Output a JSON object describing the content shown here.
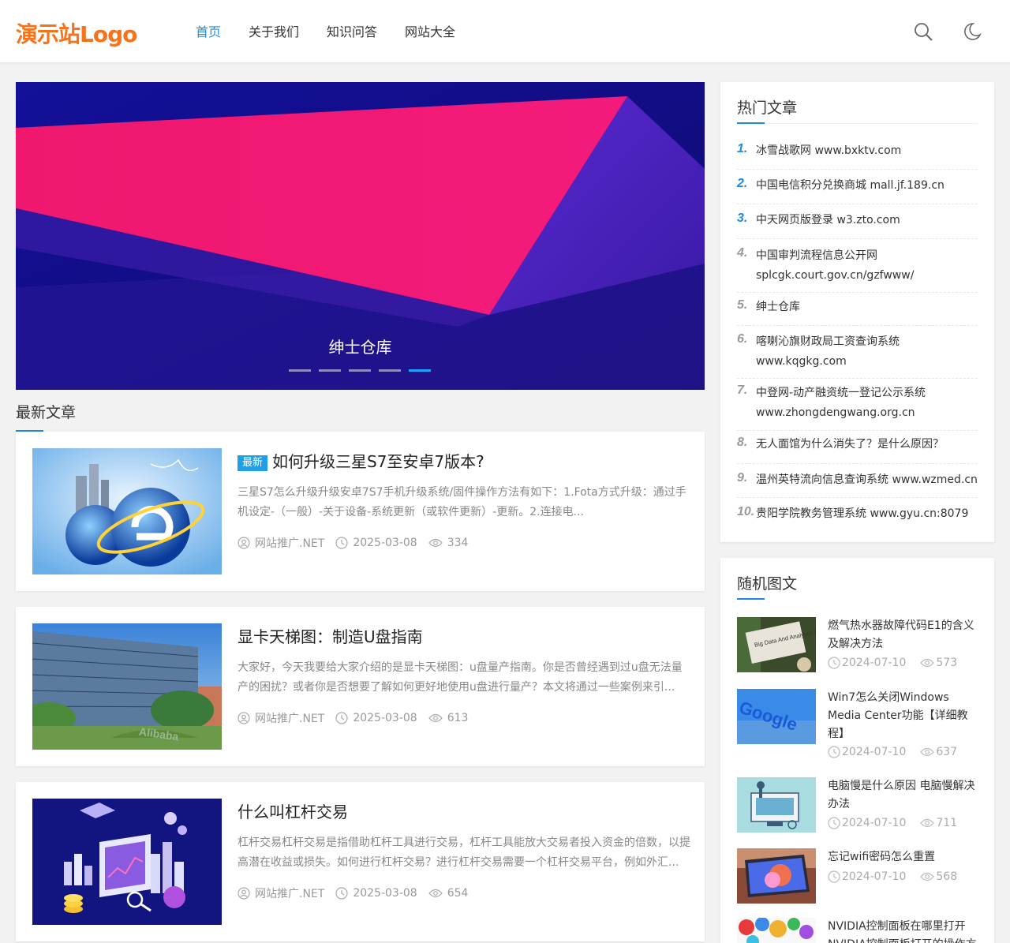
{
  "header": {
    "logo": "演示站Logo",
    "nav": [
      "首页",
      "关于我们",
      "知识问答",
      "网站大全"
    ],
    "search_icon": "search-icon",
    "theme_icon": "moon-icon"
  },
  "banner": {
    "caption": "绅士仓库",
    "slide_count": 5,
    "active_slide": 5
  },
  "latest": {
    "title": "最新文章",
    "articles": [
      {
        "badge": "最新",
        "title": "如何升级三星S7至安卓7版本?",
        "excerpt": "三星S7怎么升级升级安卓7S7手机升级系统/固件操作方法有如下：1.Fota方式升级：通过手机设定-（一般）-关于设备-系统更新（或软件更新）-更新。2.连接电...",
        "author": "网站推广.NET",
        "date": "2025-03-08",
        "views": "334"
      },
      {
        "badge": "",
        "title": "显卡天梯图：制造U盘指南",
        "excerpt": "大家好，今天我要给大家介绍的是显卡天梯图：u盘量产指南。你是否曾经遇到过u盘无法量产的困扰？或者你是否想要了解如何更好地使用u盘进行量产？本文将通过一些案例来引...",
        "author": "网站推广.NET",
        "date": "2025-03-08",
        "views": "613"
      },
      {
        "badge": "",
        "title": "什么叫杠杆交易",
        "excerpt": "杠杆交易杠杆交易是指借助杠杆工具进行交易，杠杆工具能放大交易者投入资金的倍数，以提高潜在收益或损失。如何进行杠杆交易？进行杠杆交易需要一个杠杆交易平台，例如外汇...",
        "author": "网站推广.NET",
        "date": "2025-03-08",
        "views": "654"
      }
    ]
  },
  "hot": {
    "title": "热门文章",
    "items": [
      {
        "num": "1.",
        "text": "冰雪战歌网 www.bxktv.com"
      },
      {
        "num": "2.",
        "text": "中国电信积分兑换商城 mall.jf.189.cn"
      },
      {
        "num": "3.",
        "text": "中天网页版登录 w3.zto.com"
      },
      {
        "num": "4.",
        "text": "中国审判流程信息公开网 splcgk.court.gov.cn/gzfwww/"
      },
      {
        "num": "5.",
        "text": "绅士仓库"
      },
      {
        "num": "6.",
        "text": "喀喇沁旗财政局工资查询系统 www.kqgkg.com"
      },
      {
        "num": "7.",
        "text": "中登网-动产融资统一登记公示系统 www.zhongdengwang.org.cn"
      },
      {
        "num": "8.",
        "text": "无人面馆为什么消失了？是什么原因？"
      },
      {
        "num": "9.",
        "text": "温州英特流向信息查询系统 www.wzmed.cn"
      },
      {
        "num": "10.",
        "text": "贵阳学院教务管理系统 www.gyu.cn:8079"
      }
    ]
  },
  "random": {
    "title": "随机图文",
    "items": [
      {
        "title": "燃气热水器故障代码E1的含义及解决方法",
        "date": "2024-07-10",
        "views": "573",
        "thumb_text": "Big Data And Analytics Solutions"
      },
      {
        "title": "Win7怎么关闭Windows Media Center功能【详细教程】",
        "date": "2024-07-10",
        "views": "637",
        "thumb_text": "Google"
      },
      {
        "title": "电脑慢是什么原因 电脑慢解决办法",
        "date": "2024-07-10",
        "views": "711",
        "thumb_text": ""
      },
      {
        "title": "忘记wifi密码怎么重置",
        "date": "2024-07-10",
        "views": "568",
        "thumb_text": ""
      },
      {
        "title": "NVIDIA控制面板在哪里打开 NVIDIA控制面板打开的操作方",
        "date": "",
        "views": "",
        "thumb_text": ""
      }
    ]
  },
  "thumb_texts": {
    "article2_sign": "Alibaba"
  },
  "colors": {
    "accent": "#1e88e5",
    "logo": "#f5731d",
    "badge": "#1ea0e8"
  }
}
